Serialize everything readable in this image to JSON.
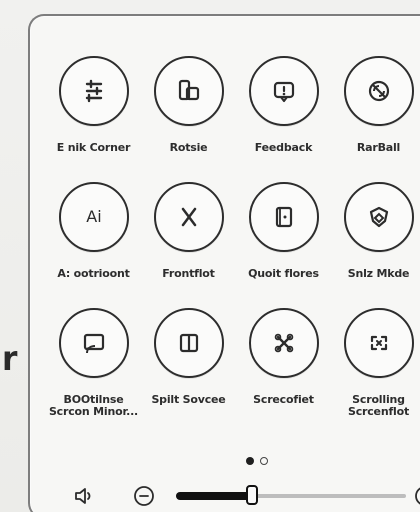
{
  "side_glyph": "r",
  "panel": {
    "tiles": [
      {
        "icon": "sliders-icon",
        "label": "E nik Corner"
      },
      {
        "icon": "rotate-icon",
        "label": "Rotsie"
      },
      {
        "icon": "feedback-icon",
        "label": "Feedback"
      },
      {
        "icon": "radar-icon",
        "label": "RarBall"
      },
      {
        "icon": "ai-icon",
        "label": "Ai",
        "subtext": "A: ootrioont"
      },
      {
        "icon": "scissors-icon",
        "label": "Frontflot"
      },
      {
        "icon": "quick-note-icon",
        "label": "Quoit flores"
      },
      {
        "icon": "shield-icon",
        "label": "Snlz Mkde"
      },
      {
        "icon": "screen-mirror-icon",
        "label": "BOOtilnse\nScrcon Minor..."
      },
      {
        "icon": "split-screen-icon",
        "label": "Spilt Sovcee"
      },
      {
        "icon": "screenshot-icon",
        "label": "Screcofiet"
      },
      {
        "icon": "scrolling-screenshot-icon",
        "label": "Scrolling\nScrcenflot"
      }
    ],
    "pager": {
      "current_page": 1,
      "total_pages": 2
    },
    "volume": {
      "level": 0.33
    }
  }
}
